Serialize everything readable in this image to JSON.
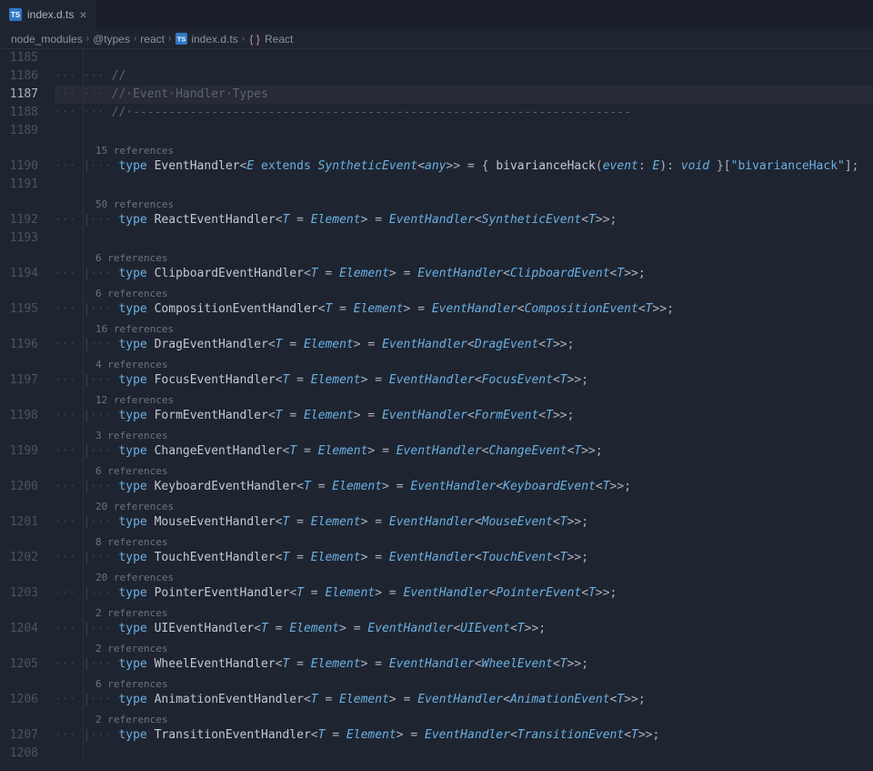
{
  "tab": {
    "filename": "index.d.ts",
    "icon": "ts-icon"
  },
  "breadcrumbs": [
    {
      "label": "node_modules"
    },
    {
      "label": "@types"
    },
    {
      "label": "react"
    },
    {
      "label": "index.d.ts",
      "icon": "ts-icon"
    },
    {
      "label": "React",
      "icon": "braces-icon"
    }
  ],
  "active_line": 1187,
  "lines": [
    {
      "n": 1185,
      "type": "blank"
    },
    {
      "n": 1186,
      "type": "comment",
      "text": "//"
    },
    {
      "n": 1187,
      "type": "comment",
      "text": "// Event Handler Types"
    },
    {
      "n": 1188,
      "type": "comment",
      "text": "// ----------------------------------------------------------------------"
    },
    {
      "n": 1189,
      "type": "blank"
    },
    {
      "n": 1190,
      "type": "evhandler",
      "refs": "15 references"
    },
    {
      "n": 1191,
      "type": "blank"
    },
    {
      "n": 1192,
      "type": "alias",
      "refs": "50 references",
      "name": "ReactEventHandler",
      "event": "SyntheticEvent"
    },
    {
      "n": 1193,
      "type": "blank"
    },
    {
      "n": 1194,
      "type": "alias",
      "refs": "6 references",
      "name": "ClipboardEventHandler",
      "event": "ClipboardEvent"
    },
    {
      "n": 1195,
      "type": "alias",
      "refs": "6 references",
      "name": "CompositionEventHandler",
      "event": "CompositionEvent"
    },
    {
      "n": 1196,
      "type": "alias",
      "refs": "16 references",
      "name": "DragEventHandler",
      "event": "DragEvent"
    },
    {
      "n": 1197,
      "type": "alias",
      "refs": "4 references",
      "name": "FocusEventHandler",
      "event": "FocusEvent"
    },
    {
      "n": 1198,
      "type": "alias",
      "refs": "12 references",
      "name": "FormEventHandler",
      "event": "FormEvent"
    },
    {
      "n": 1199,
      "type": "alias",
      "refs": "3 references",
      "name": "ChangeEventHandler",
      "event": "ChangeEvent"
    },
    {
      "n": 1200,
      "type": "alias",
      "refs": "6 references",
      "name": "KeyboardEventHandler",
      "event": "KeyboardEvent"
    },
    {
      "n": 1201,
      "type": "alias",
      "refs": "20 references",
      "name": "MouseEventHandler",
      "event": "MouseEvent"
    },
    {
      "n": 1202,
      "type": "alias",
      "refs": "8 references",
      "name": "TouchEventHandler",
      "event": "TouchEvent"
    },
    {
      "n": 1203,
      "type": "alias",
      "refs": "20 references",
      "name": "PointerEventHandler",
      "event": "PointerEvent"
    },
    {
      "n": 1204,
      "type": "alias",
      "refs": "2 references",
      "name": "UIEventHandler",
      "event": "UIEvent"
    },
    {
      "n": 1205,
      "type": "alias",
      "refs": "2 references",
      "name": "WheelEventHandler",
      "event": "WheelEvent"
    },
    {
      "n": 1206,
      "type": "alias",
      "refs": "6 references",
      "name": "AnimationEventHandler",
      "event": "AnimationEvent"
    },
    {
      "n": 1207,
      "type": "alias",
      "refs": "2 references",
      "name": "TransitionEventHandler",
      "event": "TransitionEvent"
    },
    {
      "n": 1208,
      "type": "blank"
    }
  ],
  "tokens": {
    "type_kw": "type",
    "extends_kw": "extends",
    "bivar": "bivarianceHack",
    "bivar_str": "\"bivarianceHack\"",
    "event_param": "event",
    "void": "void",
    "any": "any",
    "Element": "Element",
    "EventHandler": "EventHandler",
    "SyntheticEvent": "SyntheticEvent",
    "T": "T",
    "E": "E"
  }
}
